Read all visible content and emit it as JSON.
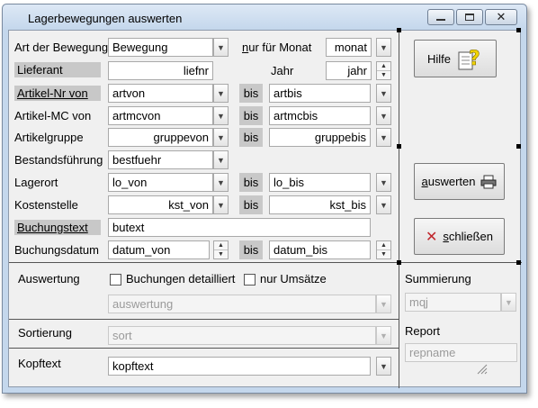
{
  "window": {
    "title": "Lagerbewegungen auswerten",
    "min_icon": "minimize-icon",
    "max_icon": "maximize-icon",
    "close_icon": "close-icon"
  },
  "form": {
    "art_label": "Art der Bewegung",
    "art_value": "Bewegung",
    "monat_label": "nur für Monat",
    "monat_value": "monat",
    "lieferant_label": "Lieferant",
    "lieferant_value": "liefnr",
    "jahr_label": "Jahr",
    "jahr_value": "jahr",
    "artikelnr_label": "Artikel-Nr von",
    "artvon_value": "artvon",
    "artbis_value": "artbis",
    "artikelmc_label": "Artikel-MC von",
    "artmcvon_value": "artmcvon",
    "artmcbis_value": "artmcbis",
    "artikelgruppe_label": "Artikelgruppe",
    "gruppevon_value": "gruppevon",
    "gruppebis_value": "gruppebis",
    "bestand_label": "Bestandsführung",
    "bestand_value": "bestfuehr",
    "lagerort_label": "Lagerort",
    "lovon_value": "lo_von",
    "lobis_value": "lo_bis",
    "kst_label": "Kostenstelle",
    "kstvon_value": "kst_von",
    "kstbis_value": "kst_bis",
    "butext_label": "Buchungstext",
    "butext_value": "butext",
    "datum_label": "Buchungsdatum",
    "datumvon_value": "datum_von",
    "datumbis_value": "datum_bis",
    "bis": "bis"
  },
  "auswertung": {
    "label": "Auswertung",
    "detail_label": "Buchungen detailliert",
    "umsatz_label": "nur Umsätze",
    "select_value": "auswertung"
  },
  "sortierung": {
    "label": "Sortierung",
    "value": "sort"
  },
  "kopftext": {
    "label": "Kopftext",
    "value": "kopftext"
  },
  "summierung": {
    "label": "Summierung",
    "value": "mqj"
  },
  "report": {
    "label": "Report",
    "value": "repname"
  },
  "buttons": {
    "hilfe": "Hilfe",
    "auswerten_u": "a",
    "auswerten_rest": "uswerten",
    "schliessen_u": "s",
    "schliessen_rest": "chließen"
  },
  "icons": {
    "help": "help-icon",
    "printer": "printer-icon",
    "close_x": "x-icon",
    "dropdown": "chevron-down-icon",
    "spin_up": "spin-up-icon",
    "spin_down": "spin-down-icon",
    "resize_grip": "resize-grip-icon"
  },
  "colors": {
    "title_bg": "#c4d7ec",
    "client_bg": "#f0f0f0",
    "label_gray": "#c8c8c8",
    "schliessen_x": "#c0262c"
  }
}
